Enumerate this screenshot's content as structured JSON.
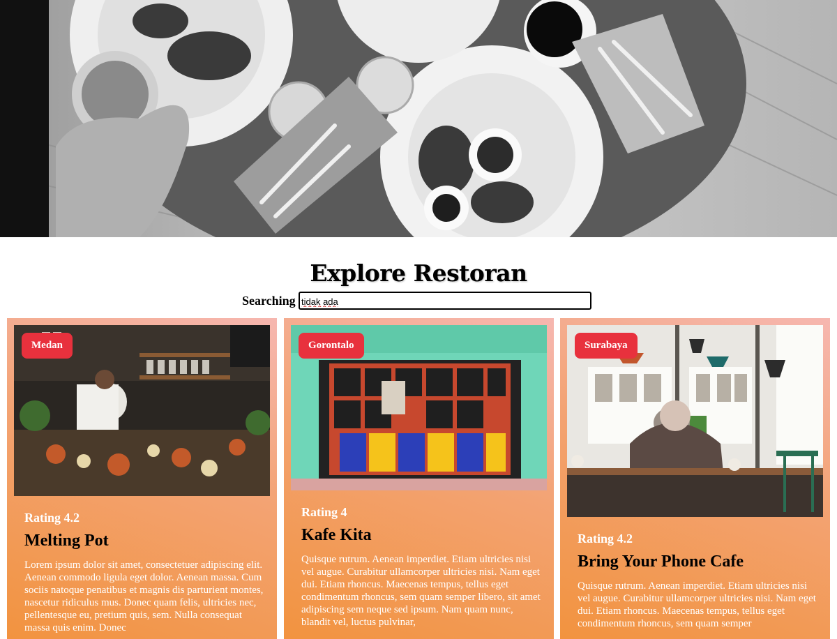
{
  "hero": {
    "image": "restaurant-table-overhead-photo"
  },
  "main": {
    "title": "Explore Restoran",
    "search": {
      "label": "Searching",
      "value": "tidak ada"
    }
  },
  "restaurants": [
    {
      "city": "Medan",
      "rating": "Rating 4.2",
      "name": "Melting Pot",
      "description": "Lorem ipsum dolor sit amet, consectetuer adipiscing elit. Aenean commodo ligula eget dolor. Aenean massa. Cum sociis natoque penatibus et magnis dis parturient montes, nascetur ridiculus mus. Donec quam felis, ultricies nec, pellentesque eu, pretium quis, sem. Nulla consequat massa quis enim. Donec"
    },
    {
      "city": "Gorontalo",
      "rating": "Rating 4",
      "name": "Kafe Kita",
      "description": "Quisque rutrum. Aenean imperdiet. Etiam ultricies nisi vel augue. Curabitur ullamcorper ultricies nisi. Nam eget dui. Etiam rhoncus. Maecenas tempus, tellus eget condimentum rhoncus, sem quam semper libero, sit amet adipiscing sem neque sed ipsum. Nam quam nunc, blandit vel, luctus pulvinar,"
    },
    {
      "city": "Surabaya",
      "rating": "Rating 4.2",
      "name": "Bring Your Phone Cafe",
      "description": "Quisque rutrum. Aenean imperdiet. Etiam ultricies nisi vel augue. Curabitur ullamcorper ultricies nisi. Nam eget dui. Etiam rhoncus. Maecenas tempus, tellus eget condimentum rhoncus, sem quam semper"
    }
  ],
  "colors": {
    "badge": "#e8313d",
    "card_gradient_top": "#f6b7b0",
    "card_gradient_bottom": "#f2933f"
  }
}
